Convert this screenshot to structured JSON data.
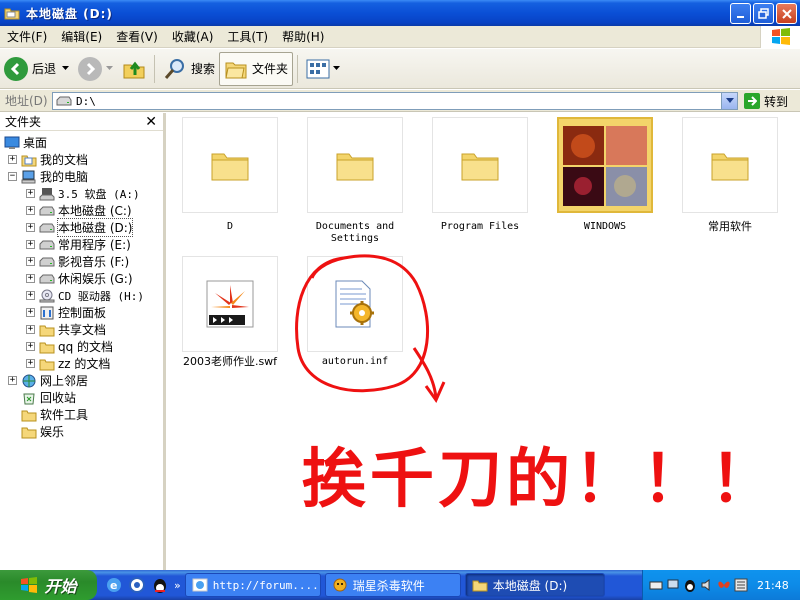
{
  "window": {
    "title": "本地磁盘 (D:)"
  },
  "menu": [
    "文件(F)",
    "编辑(E)",
    "查看(V)",
    "收藏(A)",
    "工具(T)",
    "帮助(H)"
  ],
  "toolbar": {
    "back": "后退",
    "search": "搜索",
    "folders": "文件夹"
  },
  "address": {
    "label": "地址(D)",
    "value": "D:\\",
    "go": "转到"
  },
  "folder_pane": {
    "title": "文件夹",
    "items": [
      "桌面",
      "我的文档",
      "我的电脑",
      "3.5 软盘 (A:)",
      "本地磁盘 (C:)",
      "本地磁盘 (D:)",
      "常用程序 (E:)",
      "影视音乐 (F:)",
      "休闲娱乐 (G:)",
      "CD 驱动器 (H:)",
      "控制面板",
      "共享文档",
      "qq 的文档",
      "zz 的文档",
      "网上邻居",
      "回收站",
      "软件工具",
      "娱乐"
    ]
  },
  "files": [
    {
      "name": "D"
    },
    {
      "name": "Documents and Settings"
    },
    {
      "name": "Program Files"
    },
    {
      "name": "WINDOWS"
    },
    {
      "name": "常用软件"
    },
    {
      "name": "2003老师作业.swf"
    },
    {
      "name": "autorun.inf"
    }
  ],
  "annotation": "挨千刀的！！！",
  "taskbar": {
    "start": "开始",
    "tasks": [
      "http://forum....",
      "瑞星杀毒软件",
      "本地磁盘 (D:)"
    ],
    "clock": "21:48"
  },
  "colors": {
    "titlebar": "#0a4fd6",
    "annotation": "#ee1111",
    "taskbar": "#2157d7",
    "start": "#2f9c2f"
  }
}
